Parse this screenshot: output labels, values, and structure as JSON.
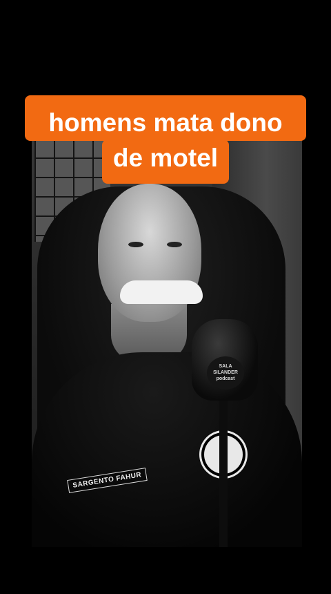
{
  "caption": {
    "line1": "homens mata dono",
    "line2": "de motel",
    "background_color": "#f26a12",
    "text_color": "#ffffff"
  },
  "video": {
    "name_tag_text": "SARGENTO FAHUR",
    "mic_badge_text": "SALA SILANDER podcast"
  }
}
